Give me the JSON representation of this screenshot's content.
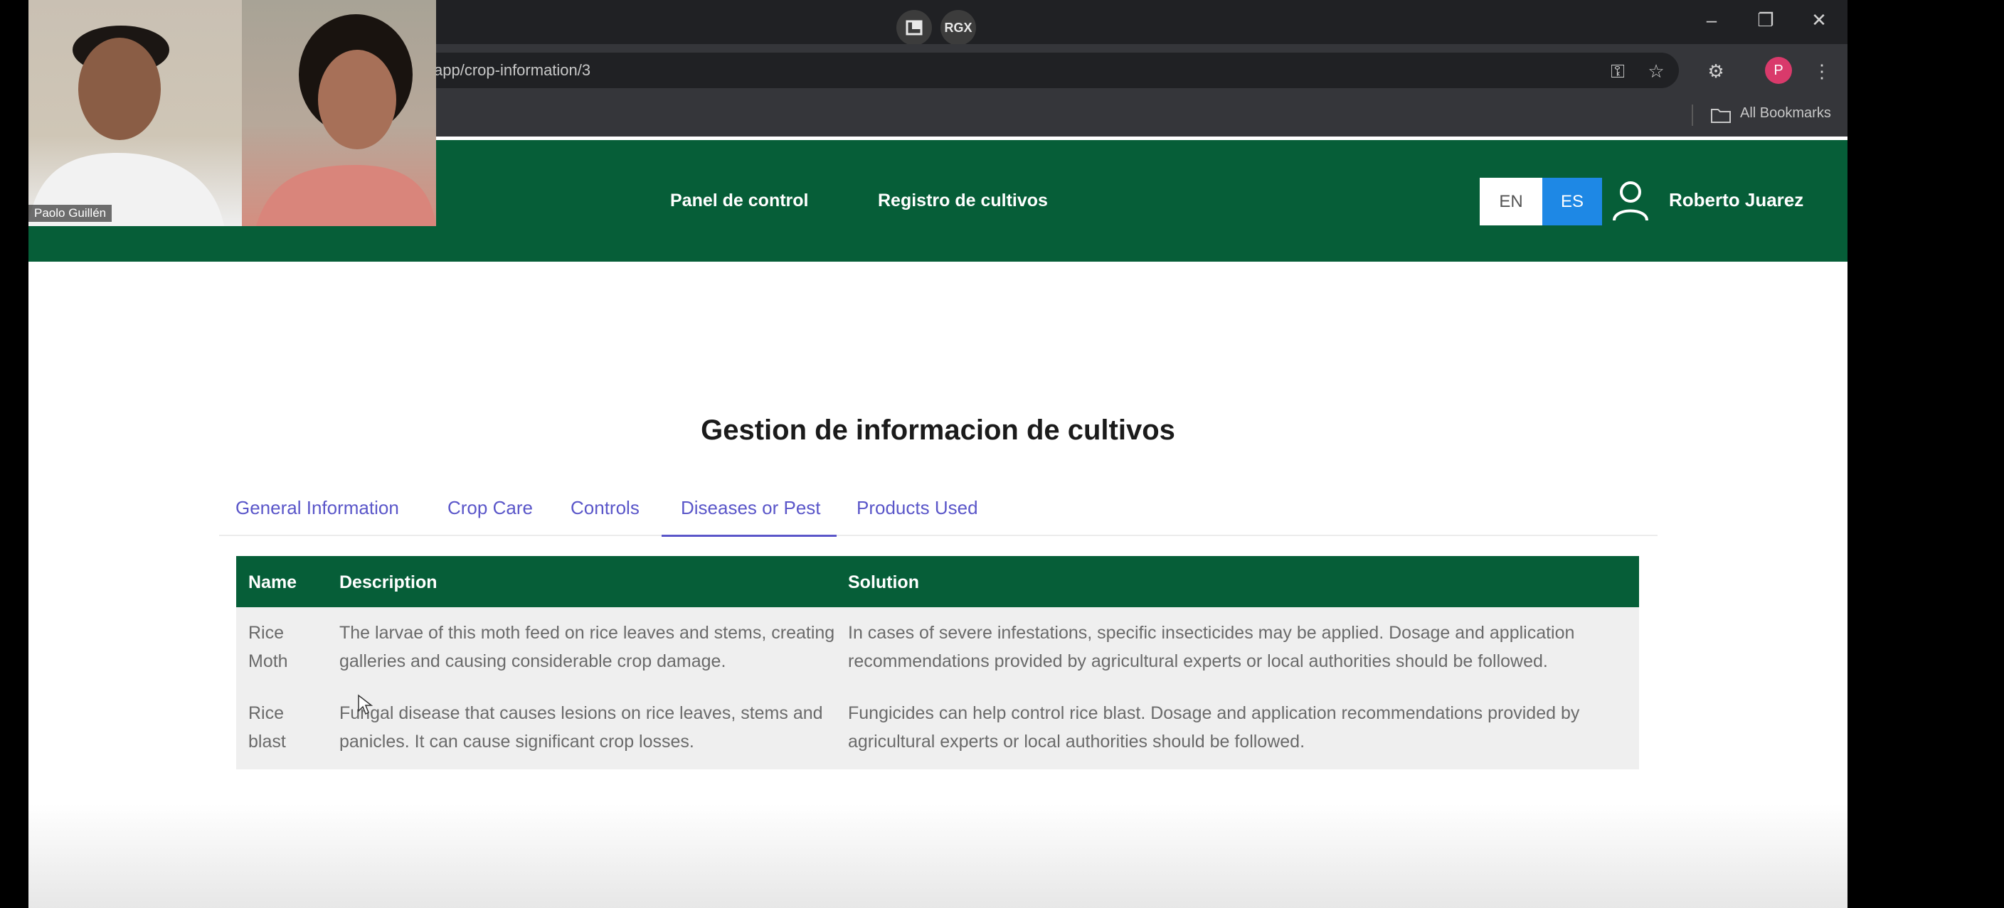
{
  "browser": {
    "address": "app/crop-information/3",
    "ext_badge_label": "RGX",
    "profile_initial": "P",
    "bookmarks_label": "All Bookmarks",
    "window_controls": [
      "minimize-icon",
      "restore-icon",
      "close-icon"
    ],
    "toolbar_icons": [
      "password-key-icon",
      "star-icon",
      "extensions-icon",
      "kebab-menu-icon"
    ]
  },
  "webcam": {
    "participant_name": "Paolo Guillén"
  },
  "app": {
    "nav": {
      "dashboard": "Panel de control",
      "crop_registry": "Registro de cultivos"
    },
    "lang": {
      "en": "EN",
      "es": "ES",
      "active": "ES"
    },
    "user_name": "Roberto Juarez",
    "colors": {
      "header": "#065e38",
      "accent": "#5a56c9",
      "lang_active": "#1e88e5"
    }
  },
  "main": {
    "title": "Gestion de informacion de cultivos",
    "tabs": [
      {
        "label": "General Information"
      },
      {
        "label": "Crop Care"
      },
      {
        "label": "Controls"
      },
      {
        "label": "Diseases or Pest",
        "active": true
      },
      {
        "label": "Products Used"
      }
    ],
    "table": {
      "headers": [
        "Name",
        "Description",
        "Solution"
      ],
      "rows": [
        {
          "name": "Rice Moth",
          "description": "The larvae of this moth feed on rice leaves and stems, creating galleries and causing considerable crop damage.",
          "solution": "In cases of severe infestations, specific insecticides may be applied. Dosage and application recommendations provided by agricultural experts or local authorities should be followed."
        },
        {
          "name": "Rice blast",
          "description": "Fungal disease that causes lesions on rice leaves, stems and panicles. It can cause significant crop losses.",
          "solution": "Fungicides can help control rice blast. Dosage and application recommendations provided by agricultural experts or local authorities should be followed."
        }
      ]
    }
  }
}
